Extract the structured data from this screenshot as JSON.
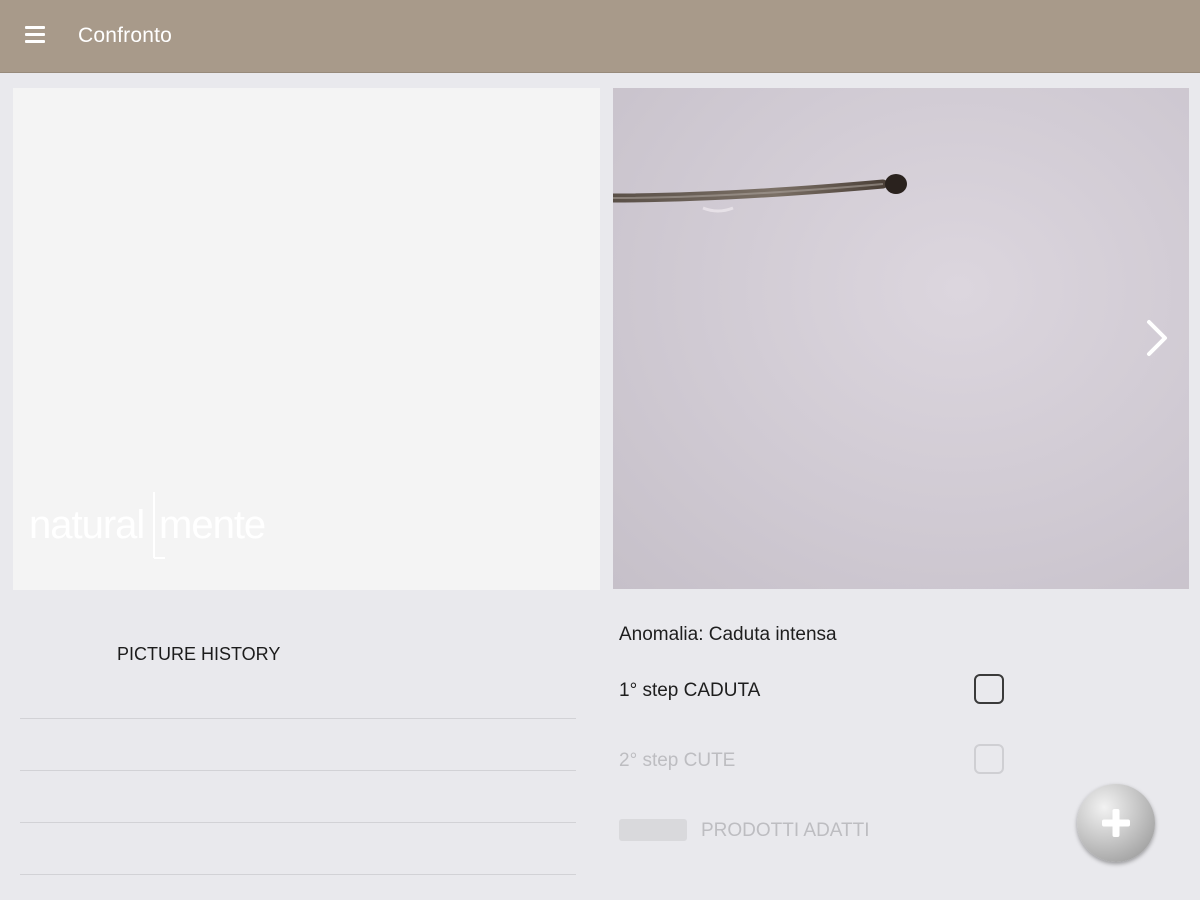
{
  "header": {
    "title": "Confronto",
    "background": "#a89a8a"
  },
  "logo": {
    "text": "naturalmente",
    "icon": "naturalmente-logo"
  },
  "history": {
    "title": "PICTURE HISTORY"
  },
  "details": {
    "anomaly": "Anomalia: Caduta intensa",
    "step1": "1° step CADUTA",
    "step2": "2° step CUTE",
    "products": "PRODOTTI ADATTI"
  },
  "icons": {
    "menu": "hamburger-menu-icon",
    "next": "chevron-right-icon",
    "add": "plus-icon"
  }
}
